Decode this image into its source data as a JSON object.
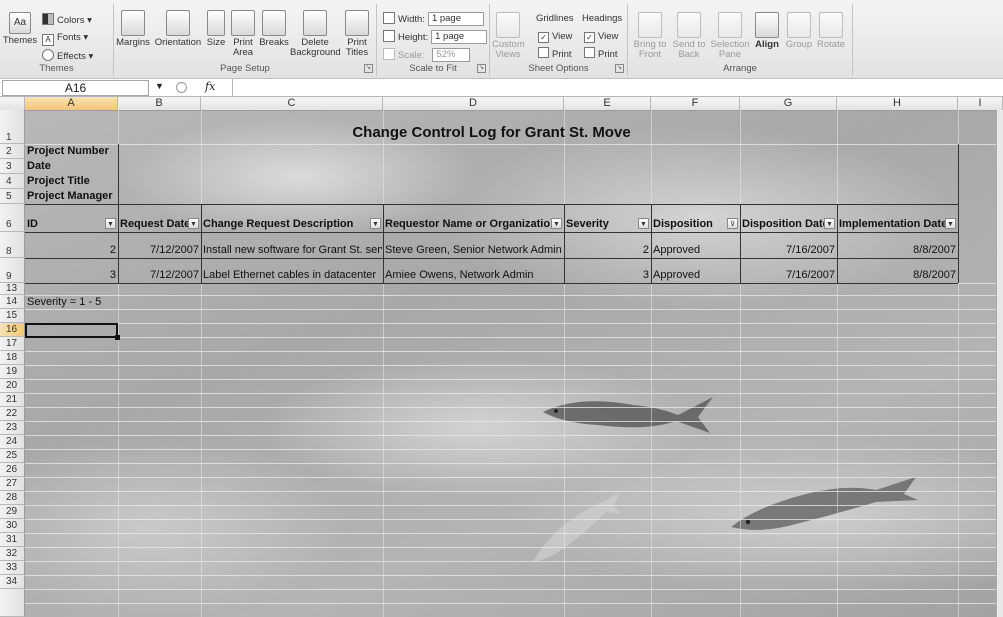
{
  "ribbon": {
    "themes": {
      "group": "Themes",
      "themes_label": "Themes",
      "colors": "Colors",
      "fonts": "Fonts",
      "effects": "Effects"
    },
    "page_setup": {
      "group": "Page Setup",
      "margins": "Margins",
      "orientation": "Orientation",
      "size": "Size",
      "print_area": "Print Area",
      "breaks": "Breaks",
      "background": "Delete Background",
      "print_titles": "Print Titles"
    },
    "scale_to_fit": {
      "group": "Scale to Fit",
      "width_label": "Width:",
      "width_value": "1 page",
      "height_label": "Height:",
      "height_value": "1 page",
      "scale_label": "Scale:",
      "scale_value": "52%"
    },
    "sheet_options": {
      "group": "Sheet Options",
      "custom_views": "Custom Views",
      "gridlines": "Gridlines",
      "headings": "Headings",
      "view": "View",
      "print": "Print"
    },
    "arrange": {
      "group": "Arrange",
      "bring_front": "Bring to Front",
      "send_back": "Send to Back",
      "selection_pane": "Selection Pane",
      "align": "Align",
      "group_btn": "Group",
      "rotate": "Rotate"
    }
  },
  "formula_bar": {
    "name_box": "A16",
    "fx": "fx",
    "formula": ""
  },
  "columns": [
    "A",
    "B",
    "C",
    "D",
    "E",
    "F",
    "G",
    "H",
    "I"
  ],
  "rows": [
    "1",
    "2",
    "3",
    "4",
    "5",
    "6",
    "8",
    "9",
    "13",
    "14",
    "15",
    "16",
    "17",
    "18",
    "19",
    "20",
    "21",
    "22",
    "23",
    "24",
    "25",
    "26",
    "27",
    "28",
    "29",
    "30",
    "31",
    "32",
    "33",
    "34"
  ],
  "sheet": {
    "title": "Change Control Log for Grant St. Move",
    "meta_labels": [
      "Project Number",
      "Date",
      "Project Title",
      "Project Manager"
    ],
    "headers": [
      "ID",
      "Request Date",
      "Change Request Description",
      "Requestor Name or Organization",
      "Severity",
      "Disposition",
      "Disposition Date",
      "Implementation Date"
    ],
    "records": [
      [
        "2",
        "7/12/2007",
        "Install new software for Grant St. server",
        "Steve Green, Senior Network Admin",
        "2",
        "Approved",
        "7/16/2007",
        "8/8/2007"
      ],
      [
        "3",
        "7/12/2007",
        "Label Ethernet cables in datacenter",
        "Amiee Owens, Network Admin",
        "3",
        "Approved",
        "7/16/2007",
        "8/8/2007"
      ]
    ],
    "note": "Severity = 1 - 5"
  }
}
